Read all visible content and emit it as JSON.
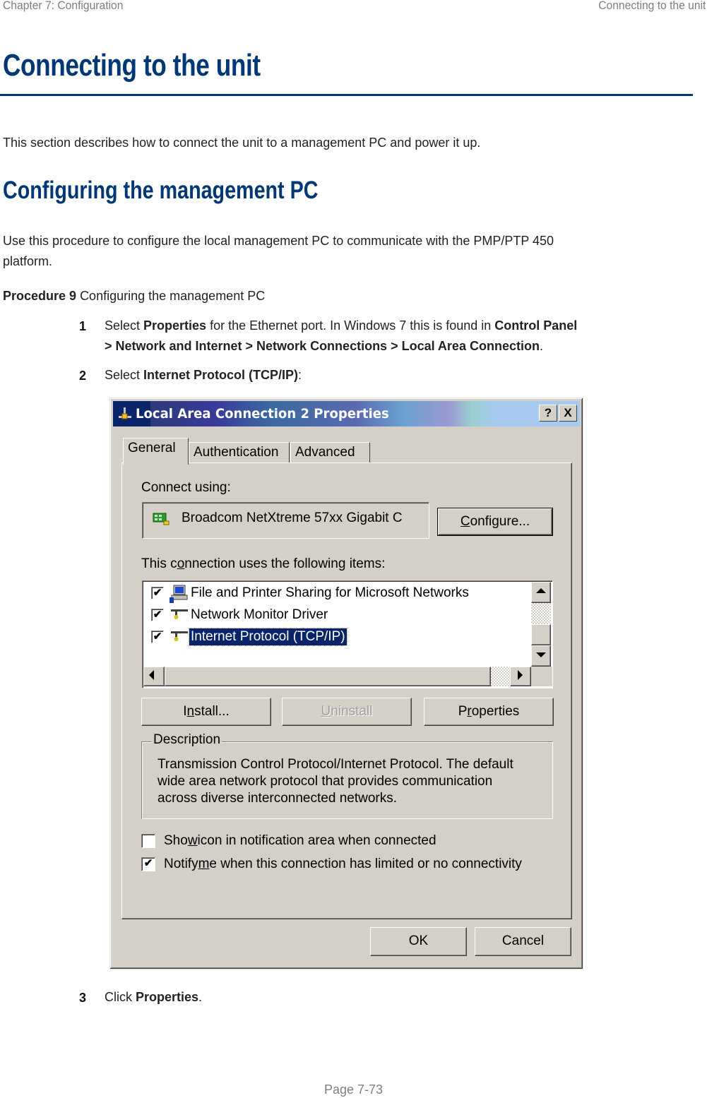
{
  "page_header": {
    "chapter": "Chapter 7:  Configuration",
    "section": "Connecting to the unit"
  },
  "heading1": "Connecting to the unit",
  "intro": "This section describes how to connect the unit to a management PC and power it up.",
  "heading2": "Configuring the management PC",
  "body_para": {
    "line1": "Use this procedure to configure the local management PC to communicate with the PMP/PTP 450",
    "line2": "platform."
  },
  "procedure": {
    "label": "Procedure 9",
    "title": "Configuring the management PC"
  },
  "steps": [
    {
      "num": "1",
      "parts": {
        "a": "Select ",
        "b": "Properties",
        "c": " for the Ethernet port. In Windows 7 this is found in ",
        "d": "Control Panel",
        "e": "> Network and Internet > Network Connections > Local Area Connection",
        "f": "."
      }
    },
    {
      "num": "2",
      "parts": {
        "a": "Select ",
        "b": "Internet Protocol (TCP/IP)",
        "c": ":"
      }
    },
    {
      "num": "3",
      "parts": {
        "a": "Click ",
        "b": "Properties",
        "c": "."
      }
    }
  ],
  "dialog": {
    "title": "Local Area Connection 2 Properties",
    "help_btn": "?",
    "close_btn": "X",
    "tabs": [
      {
        "label": "General",
        "active": true
      },
      {
        "label": "Authentication",
        "active": false
      },
      {
        "label": "Advanced",
        "active": false
      }
    ],
    "connect_using_label": "Connect using:",
    "adapter_name": "Broadcom NetXtreme 57xx Gigabit C",
    "configure_btn": {
      "pre": "",
      "ul": "C",
      "post": "onfigure..."
    },
    "items_label": {
      "pre": "This c",
      "ul": "o",
      "post": "nnection uses the following items:"
    },
    "items": [
      {
        "label": "File and Printer Sharing for Microsoft Networks",
        "checked": true,
        "icon": "computer-icon",
        "selected": false
      },
      {
        "label": "Network Monitor Driver",
        "checked": true,
        "icon": "network-protocol-icon",
        "selected": false
      },
      {
        "label": "Internet Protocol (TCP/IP)",
        "checked": true,
        "icon": "network-protocol-icon",
        "selected": true
      }
    ],
    "install_btn": {
      "pre": "I",
      "ul": "n",
      "post": "stall..."
    },
    "uninstall_btn": {
      "pre": "",
      "ul": "U",
      "post": "ninstall"
    },
    "properties_btn": {
      "pre": "P",
      "ul": "r",
      "post": "operties"
    },
    "description_title": "Description",
    "description_lines": [
      "Transmission Control Protocol/Internet Protocol. The default",
      "wide area network protocol that provides communication",
      "across diverse interconnected networks."
    ],
    "show_icon": {
      "pre": "Sho",
      "ul": "w",
      "post": " icon in notification area when connected",
      "checked": false
    },
    "notify": {
      "pre": "Notify ",
      "ul": "m",
      "post": "e when this connection has limited or no connectivity",
      "checked": true
    },
    "ok_btn": "OK",
    "cancel_btn": "Cancel",
    "check_glyph": "✔"
  },
  "footer": "Page 7-73",
  "colors": {
    "heading_blue": "#003876",
    "dialog_face": "#d4d0c8",
    "selection": "#0a246a"
  }
}
